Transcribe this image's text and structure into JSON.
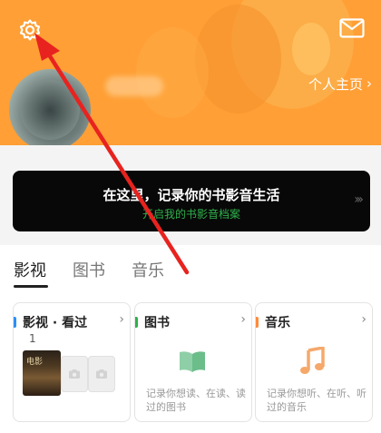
{
  "header": {
    "profile_link": "个人主页",
    "settings_icon": "gear-icon",
    "mail_icon": "mail-icon",
    "color": "#ff9f35"
  },
  "banner": {
    "title": "在这里，记录你的书影音生活",
    "subtitle": "开启我的书影音档案",
    "arrows": "›››",
    "subtitle_color": "#2fb14b"
  },
  "tabs": [
    {
      "label": "影视",
      "active": true
    },
    {
      "label": "图书",
      "active": false
    },
    {
      "label": "音乐",
      "active": false
    }
  ],
  "cards": [
    {
      "title": "影视 · 看过",
      "count": "1",
      "accent": "#2c8ef8",
      "poster_text": "电影"
    },
    {
      "title": "图书",
      "description": "记录你想读、在读、读过的图书",
      "accent": "#2fb14b",
      "icon": "book-icon"
    },
    {
      "title": "音乐",
      "description": "记录你想听、在听、听过的音乐",
      "accent": "#ff8a3d",
      "icon": "music-note-icon"
    }
  ],
  "annotation": {
    "type": "red-arrow",
    "points_to": "settings-gear-button",
    "color": "#e8231f"
  }
}
